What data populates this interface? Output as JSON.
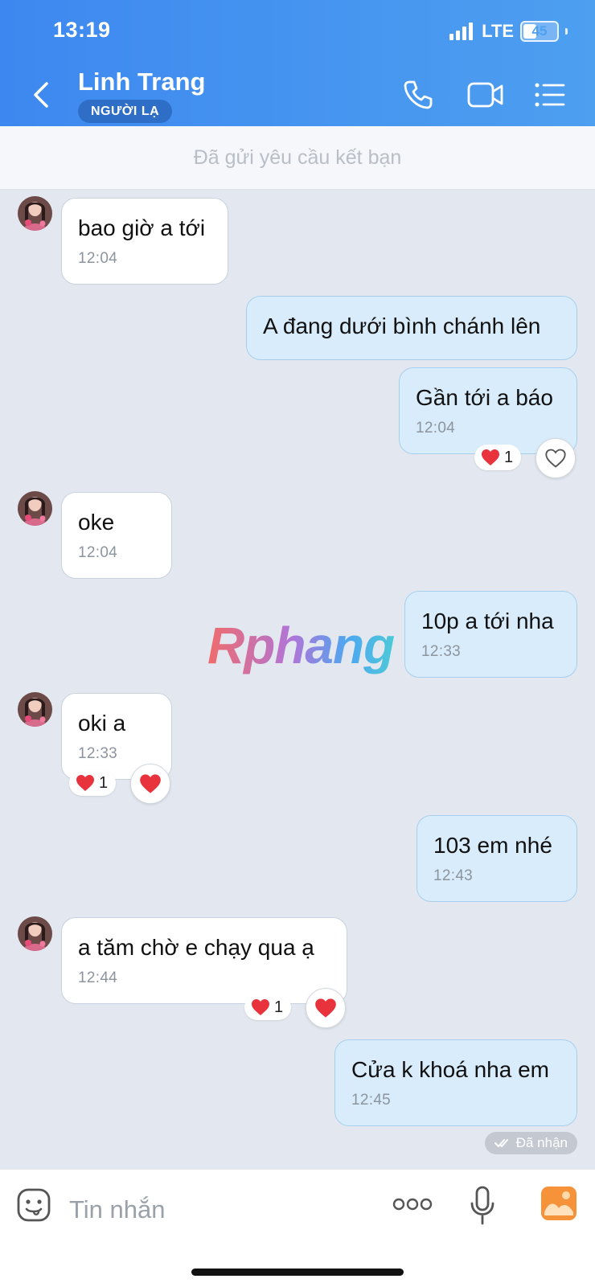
{
  "status_bar": {
    "time": "13:19",
    "network": "LTE",
    "battery": "45",
    "battery_percent": 45
  },
  "header": {
    "contact_name": "Linh Trang",
    "badge": "NGƯỜI LẠ"
  },
  "banner": {
    "text": "Đã gửi yêu cầu kết bạn"
  },
  "messages": [
    {
      "dir": "in",
      "text": "bao giờ a tới",
      "time": "12:04"
    },
    {
      "dir": "out",
      "text": "A đang dưới bình chánh lên",
      "time": ""
    },
    {
      "dir": "out",
      "text": "Gần tới a báo",
      "time": "12:04",
      "reaction_count": "1"
    },
    {
      "dir": "in",
      "text": "oke",
      "time": "12:04"
    },
    {
      "dir": "out",
      "text": "10p a tới nha",
      "time": "12:33"
    },
    {
      "dir": "in",
      "text": "oki a",
      "time": "12:33",
      "reaction_count": "1"
    },
    {
      "dir": "out",
      "text": "103 em nhé",
      "time": "12:43"
    },
    {
      "dir": "in",
      "text": "a tăm chờ e chạy qua ạ",
      "time": "12:44",
      "reaction_count": "1"
    },
    {
      "dir": "out",
      "text": "Cửa k khoá nha em",
      "time": "12:45"
    }
  ],
  "watermark": "Rphang",
  "seen_status": "Đã nhận",
  "composer": {
    "placeholder": "Tin nhắn"
  },
  "colors": {
    "header": "#4d9ff0",
    "outgoing_bubble": "#d9ecfb",
    "incoming_bubble": "#ffffff",
    "background": "#e3e8f0",
    "heart": "#e8323c",
    "image_button": "#f5923a"
  },
  "icons": [
    "back-icon",
    "phone-icon",
    "video-call-icon",
    "menu-list-icon",
    "heart-icon",
    "double-check-icon",
    "sticker-icon",
    "more-icon",
    "microphone-icon",
    "image-icon"
  ]
}
